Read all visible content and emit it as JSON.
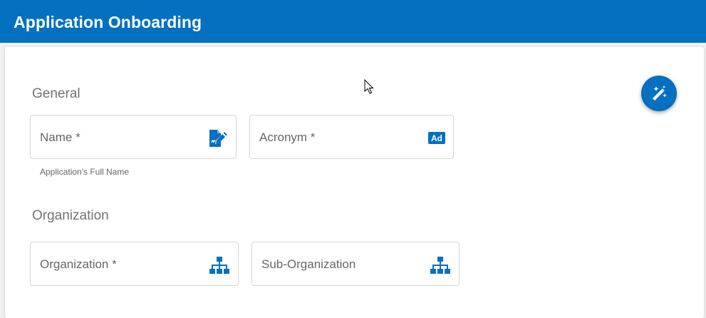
{
  "header": {
    "title": "Application Onboarding"
  },
  "sections": {
    "general": {
      "title": "General",
      "name_field": {
        "placeholder": "Name *",
        "value": "",
        "helper": "Application's Full Name",
        "icon": "signature-document-icon"
      },
      "acronym_field": {
        "placeholder": "Acronym *",
        "value": "",
        "icon": "ad-badge-icon",
        "icon_text": "Ad"
      }
    },
    "organization": {
      "title": "Organization",
      "organization_field": {
        "placeholder": "Organization *",
        "value": "",
        "icon": "org-chart-icon"
      },
      "sub_organization_field": {
        "placeholder": "Sub-Organization",
        "value": "",
        "icon": "org-chart-icon"
      }
    }
  },
  "fab": {
    "icon": "magic-wand-icon"
  },
  "colors": {
    "primary": "#0470c0",
    "header_text": "#ffffff",
    "label_text": "#666666",
    "section_text": "#727272",
    "border": "#d6d6d6"
  }
}
